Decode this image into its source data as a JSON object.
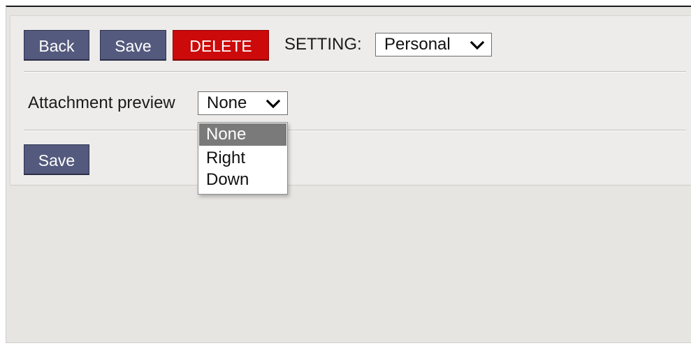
{
  "toolbar": {
    "back_label": "Back",
    "save_label": "Save",
    "delete_label": "DELETE",
    "setting_label": "SETTING:",
    "setting_value": "Personal"
  },
  "form": {
    "attachment_preview_label": "Attachment preview",
    "attachment_preview_value": "None",
    "save_label": "Save"
  },
  "dropdown": {
    "options": [
      "None",
      "Right",
      "Down"
    ],
    "highlighted": "None"
  },
  "colors": {
    "nav_button": "#545a7d",
    "delete_button": "#cc0a0a",
    "highlight": "#7a7a7a"
  },
  "icons": {
    "select_arrow": "chevron-down-icon"
  }
}
